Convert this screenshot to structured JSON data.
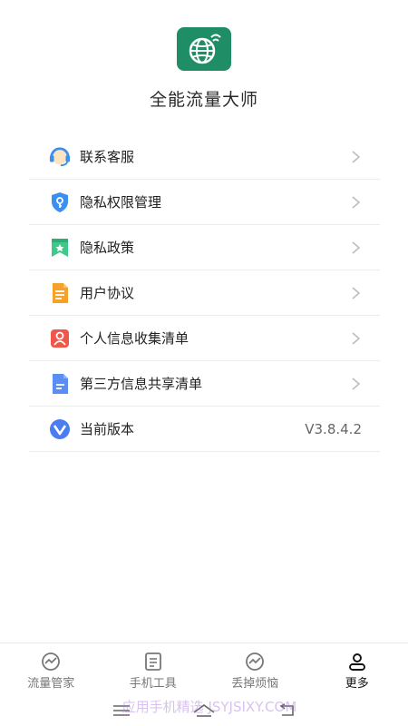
{
  "app": {
    "name": "全能流量大师"
  },
  "menu": [
    {
      "label": "联系客服",
      "icon": "headset-icon"
    },
    {
      "label": "隐私权限管理",
      "icon": "shield-key-icon"
    },
    {
      "label": "隐私政策",
      "icon": "bookmark-star-icon"
    },
    {
      "label": "用户协议",
      "icon": "document-icon"
    },
    {
      "label": "个人信息收集清单",
      "icon": "person-icon"
    },
    {
      "label": "第三方信息共享清单",
      "icon": "file-icon"
    },
    {
      "label": "当前版本",
      "icon": "v-badge-icon",
      "value": "V3.8.4.2"
    }
  ],
  "tabs": [
    {
      "label": "流量管家",
      "icon": "chart-circle-icon",
      "active": false
    },
    {
      "label": "手机工具",
      "icon": "list-icon",
      "active": false
    },
    {
      "label": "丢掉烦恼",
      "icon": "chart-circle-icon",
      "active": false
    },
    {
      "label": "更多",
      "icon": "user-icon",
      "active": true
    }
  ],
  "watermark": {
    "text": "应用手机精选 JSYJSIXY.COM"
  },
  "colors": {
    "brand": "#1f8d66",
    "divider": "#ececec",
    "text": "#222222",
    "muted": "#777777"
  }
}
